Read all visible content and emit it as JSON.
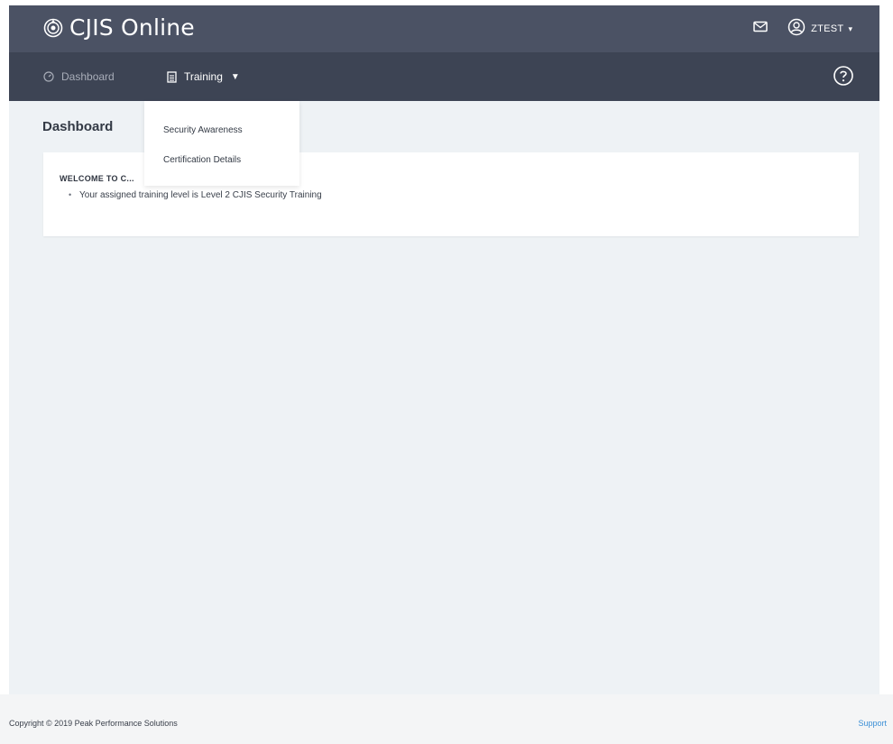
{
  "app": {
    "title": "CJIS Online"
  },
  "header": {
    "user_name": "ZTEST",
    "user_caret": "▾"
  },
  "nav": {
    "dashboard_label": "Dashboard",
    "training_label": "Training",
    "training_caret": "▼"
  },
  "dropdown": {
    "items": [
      {
        "label": "Security Awareness"
      },
      {
        "label": "Certification Details"
      }
    ]
  },
  "main": {
    "page_title": "Dashboard",
    "welcome_title": "WELCOME TO C...",
    "bullets": [
      {
        "text": "Your assigned training level is Level 2 CJIS Security Training"
      }
    ]
  },
  "footer": {
    "copyright": "Copyright © 2019 Peak Performance Solutions",
    "support_label": "Support"
  },
  "colors": {
    "topbar": "#4b5264",
    "navbar": "#3d4454",
    "content_bg": "#eef2f5",
    "link": "#3b8fd6"
  },
  "icons": {
    "logo": "cjis-logo-icon",
    "mail": "mail-icon",
    "user": "user-circle-icon",
    "dashboard": "dashboard-gauge-icon",
    "training": "document-icon",
    "help": "help-circle-icon"
  }
}
